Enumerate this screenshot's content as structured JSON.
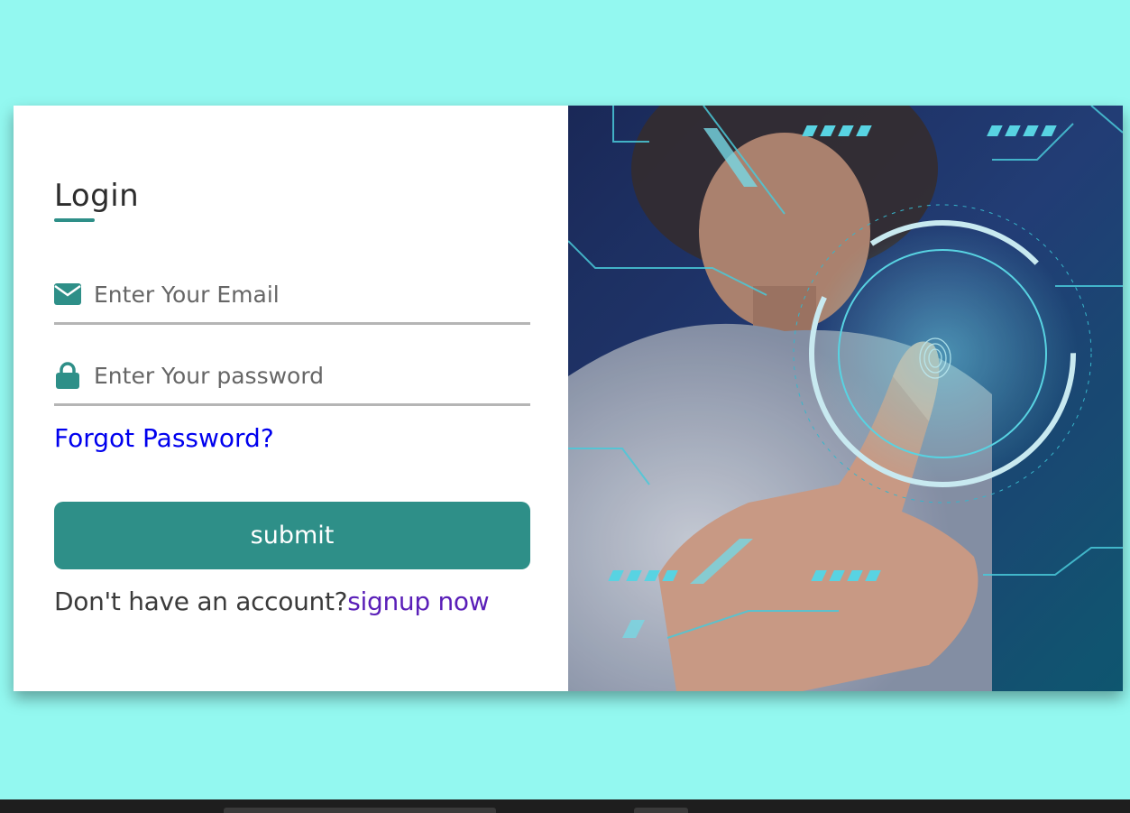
{
  "login": {
    "title": "Login",
    "email_placeholder": "Enter Your Email",
    "password_placeholder": "Enter Your password",
    "forgot_label": "Forgot Password?",
    "submit_label": "submit",
    "no_account_text": "Don't have an account?",
    "signup_label": "signup now"
  },
  "icons": {
    "email": "envelope-icon",
    "password": "lock-icon"
  },
  "colors": {
    "page_background": "#93f8f0",
    "accent": "#2e8f88",
    "link": "#0000ee",
    "signup_link": "#5a1fb8"
  }
}
